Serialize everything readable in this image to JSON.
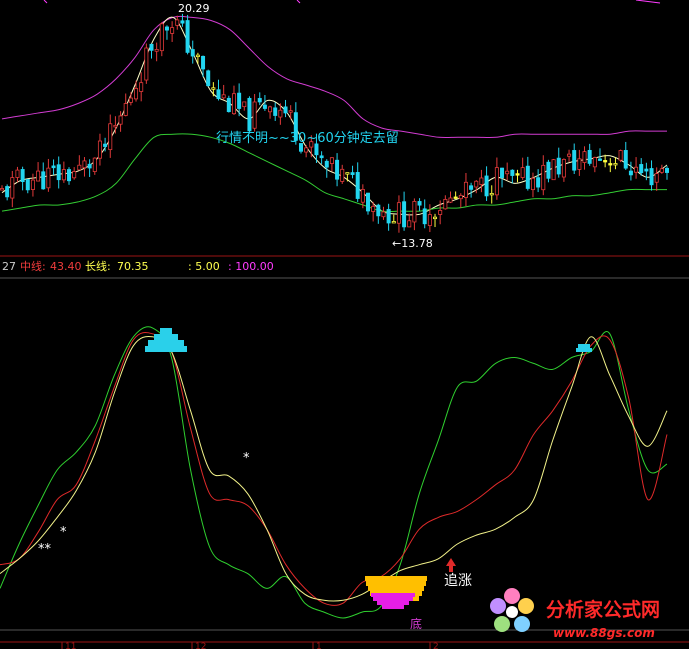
{
  "colors": {
    "background": "#000000",
    "candle_up": "#e33a3a",
    "candle_down": "#22d5f0",
    "candle_flat": "#ffff40",
    "upper_band": "#d23cd2",
    "middle_line": "#ffffc8",
    "lower_band": "#33cc33",
    "panel_divider": "#9b1414",
    "ind_green": "#2fcf2f",
    "ind_red": "#e02a2a",
    "ind_yellow": "#f2f28a",
    "block_cyan": "#2ad0ea",
    "block_orange": "#ffbf00",
    "block_magenta": "#e61ee6",
    "legend_label_red": "#f03c3c",
    "legend_value_yellow": "#ffff50",
    "legend_magenta": "#ff3cff",
    "watermark_red": "#ff2a2a"
  },
  "price_panel": {
    "high_label": "20.29",
    "low_label": "←13.78",
    "annotation": "行情不明~~30~60分钟定去留",
    "price_range": [
      12.8,
      20.8
    ]
  },
  "legend": {
    "prefix": "27",
    "mid_label": "中线:",
    "mid_value": "43.40",
    "long_label": "长线:",
    "long_value": "70.35",
    "p1": ": 5.00",
    "p2": ": 100.00"
  },
  "indicator_panel": {
    "range": [
      0,
      100
    ],
    "labels": {
      "star_a": "**",
      "star_b": "*",
      "star_c": "*",
      "chase": "追涨",
      "bottom": "底"
    }
  },
  "bottom_axis": {
    "ticks": [
      "11",
      "12",
      "1",
      "2"
    ]
  },
  "watermark": {
    "title": "分析家公式网",
    "url": "www.88gs.com"
  },
  "chart_data": [
    {
      "type": "candlestick",
      "series": [
        {
          "name": "upper",
          "values": [
            17.0,
            17.1,
            17.2,
            17.3,
            17.5,
            17.8,
            18.3,
            19.0,
            19.9,
            20.3,
            20.3,
            20.2,
            19.9,
            19.3,
            18.7,
            18.3,
            18.1,
            17.9,
            17.6,
            17.0,
            16.7,
            16.6,
            16.5,
            16.4,
            16.4,
            16.4,
            16.4,
            16.5,
            16.5,
            16.5,
            16.5,
            16.5,
            16.5,
            16.6,
            16.6,
            16.6
          ]
        },
        {
          "name": "middle",
          "values": [
            14.6,
            15.0,
            15.1,
            15.2,
            15.3,
            15.7,
            16.7,
            18.1,
            19.6,
            20.3,
            19.2,
            17.9,
            17.5,
            17.0,
            17.6,
            17.2,
            16.1,
            15.4,
            15.1,
            14.6,
            14.0,
            13.9,
            13.9,
            14.2,
            14.4,
            14.7,
            15.1,
            14.9,
            15.1,
            15.4,
            15.6,
            15.7,
            15.8,
            15.5,
            15.1,
            15.5
          ]
        },
        {
          "name": "lower",
          "values": [
            14.0,
            14.1,
            14.2,
            14.2,
            14.3,
            14.5,
            14.9,
            15.7,
            16.4,
            16.5,
            16.5,
            16.4,
            16.2,
            15.9,
            15.6,
            15.3,
            15.0,
            14.6,
            14.4,
            14.2,
            14.0,
            14.0,
            14.0,
            14.1,
            14.1,
            14.2,
            14.2,
            14.3,
            14.4,
            14.4,
            14.5,
            14.5,
            14.6,
            14.7,
            14.7,
            14.7
          ]
        }
      ]
    },
    {
      "type": "line",
      "series": [
        {
          "name": "green",
          "values": [
            10,
            25,
            38,
            50,
            56,
            65,
            82,
            95,
            98,
            88,
            50,
            24,
            18,
            15,
            10,
            14,
            5,
            2,
            0,
            2,
            4,
            18,
            42,
            60,
            78,
            80,
            86,
            88,
            86,
            84,
            88,
            90,
            96,
            70,
            50,
            52
          ]
        },
        {
          "name": "red",
          "values": [
            18,
            20,
            29,
            40,
            45,
            60,
            78,
            94,
            96,
            90,
            64,
            42,
            40,
            38,
            30,
            18,
            10,
            5,
            5,
            12,
            14,
            20,
            30,
            34,
            36,
            40,
            45,
            50,
            62,
            70,
            80,
            92,
            94,
            74,
            40,
            62
          ]
        },
        {
          "name": "yellow",
          "values": [
            15,
            20,
            26,
            34,
            43,
            56,
            76,
            92,
            95,
            90,
            70,
            50,
            48,
            42,
            30,
            15,
            8,
            6,
            6,
            8,
            12,
            16,
            18,
            20,
            25,
            28,
            30,
            34,
            40,
            60,
            78,
            95,
            82,
            68,
            58,
            70
          ]
        }
      ]
    }
  ]
}
